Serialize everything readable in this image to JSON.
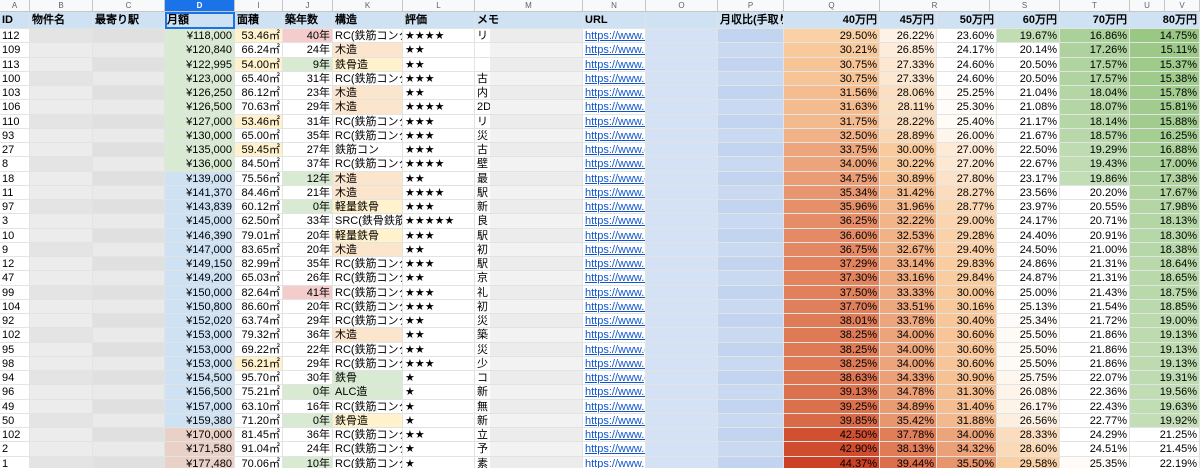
{
  "column_letters": [
    "A",
    "B",
    "C",
    "D",
    "I",
    "J",
    "K",
    "L",
    "M",
    "N",
    "O",
    "P",
    "Q",
    "R",
    "S",
    "T",
    "U",
    "V"
  ],
  "headers": {
    "id": "ID",
    "name": "物件名",
    "station": "最寄り駅",
    "rent": "月額",
    "area": "面積",
    "age": "築年数",
    "structure": "構造",
    "rating": "評価",
    "memo": "メモ",
    "url": "URL",
    "income_ratio": "月収比(手取り)",
    "p40": "40万円",
    "p45": "45万円",
    "p50": "50万円",
    "p60": "60万円",
    "p70": "70万円",
    "p80": "80万円"
  },
  "colors": {
    "header_bg": "#cfe2f3",
    "selected_col": "#1a73e8",
    "link": "#1155cc"
  },
  "rows": [
    {
      "id": "112",
      "rent": "¥118,000",
      "area": "53.46㎡",
      "age": "40年",
      "structure": "RC(鉄筋コンクリ",
      "rating": "★★★★",
      "memo": "リ",
      "url": "https://www.ho",
      "p40": "29.50%",
      "p45": "26.22%",
      "p50": "23.60%",
      "p60": "19.67%",
      "p70": "16.86%",
      "p80": "14.75%"
    },
    {
      "id": "109",
      "rent": "¥120,840",
      "area": "66.24㎡",
      "age": "24年",
      "structure": "木造",
      "rating": "★★",
      "memo": "",
      "url": "https://www.ho",
      "p40": "30.21%",
      "p45": "26.85%",
      "p50": "24.17%",
      "p60": "20.14%",
      "p70": "17.26%",
      "p80": "15.11%"
    },
    {
      "id": "113",
      "rent": "¥122,995",
      "area": "54.00㎡",
      "age": "9年",
      "structure": "鉄骨造",
      "rating": "★★",
      "memo": "",
      "url": "https://www.ho",
      "p40": "30.75%",
      "p45": "27.33%",
      "p50": "24.60%",
      "p60": "20.50%",
      "p70": "17.57%",
      "p80": "15.37%"
    },
    {
      "id": "100",
      "rent": "¥123,000",
      "area": "65.40㎡",
      "age": "31年",
      "structure": "RC(鉄筋コンクリ",
      "rating": "★★★",
      "memo": "古",
      "url": "https://www.ho",
      "p40": "30.75%",
      "p45": "27.33%",
      "p50": "24.60%",
      "p60": "20.50%",
      "p70": "17.57%",
      "p80": "15.38%"
    },
    {
      "id": "103",
      "rent": "¥126,250",
      "area": "86.12㎡",
      "age": "23年",
      "structure": "木造",
      "rating": "★★",
      "memo": "内",
      "url": "https://www.ho",
      "p40": "31.56%",
      "p45": "28.06%",
      "p50": "25.25%",
      "p60": "21.04%",
      "p70": "18.04%",
      "p80": "15.78%"
    },
    {
      "id": "106",
      "rent": "¥126,500",
      "area": "70.63㎡",
      "age": "29年",
      "structure": "木造",
      "rating": "★★★★",
      "memo": "2D",
      "url": "https://www.ho",
      "p40": "31.63%",
      "p45": "28.11%",
      "p50": "25.30%",
      "p60": "21.08%",
      "p70": "18.07%",
      "p80": "15.81%"
    },
    {
      "id": "110",
      "rent": "¥127,000",
      "area": "53.46㎡",
      "age": "31年",
      "structure": "RC(鉄筋コンクリ",
      "rating": "★★★",
      "memo": "リ",
      "url": "https://www.ho",
      "p40": "31.75%",
      "p45": "28.22%",
      "p50": "25.40%",
      "p60": "21.17%",
      "p70": "18.14%",
      "p80": "15.88%"
    },
    {
      "id": "93",
      "rent": "¥130,000",
      "area": "65.00㎡",
      "age": "35年",
      "structure": "RC(鉄筋コンクリ",
      "rating": "★★★",
      "memo": "災",
      "url": "https://www.ho",
      "p40": "32.50%",
      "p45": "28.89%",
      "p50": "26.00%",
      "p60": "21.67%",
      "p70": "18.57%",
      "p80": "16.25%"
    },
    {
      "id": "27",
      "rent": "¥135,000",
      "area": "59.45㎡",
      "age": "27年",
      "structure": "鉄筋コン",
      "rating": "★★★",
      "memo": "古",
      "url": "https://www.go",
      "p40": "33.75%",
      "p45": "30.00%",
      "p50": "27.00%",
      "p60": "22.50%",
      "p70": "19.29%",
      "p80": "16.88%"
    },
    {
      "id": "8",
      "rent": "¥136,000",
      "area": "84.50㎡",
      "age": "37年",
      "structure": "RC(鉄筋コンクリ",
      "rating": "★★★★",
      "memo": "壁",
      "url": "https://www.ho",
      "p40": "34.00%",
      "p45": "30.22%",
      "p50": "27.20%",
      "p60": "22.67%",
      "p70": "19.43%",
      "p80": "17.00%"
    },
    {
      "id": "18",
      "rent": "¥139,000",
      "area": "75.56㎡",
      "age": "12年",
      "structure": "木造",
      "rating": "★★",
      "memo": "最",
      "url": "https://www.go",
      "p40": "34.75%",
      "p45": "30.89%",
      "p50": "27.80%",
      "p60": "23.17%",
      "p70": "19.86%",
      "p80": "17.38%"
    },
    {
      "id": "11",
      "rent": "¥141,370",
      "area": "84.46㎡",
      "age": "21年",
      "structure": "木造",
      "rating": "★★★★",
      "memo": "駅",
      "url": "https://www.ho",
      "p40": "35.34%",
      "p45": "31.42%",
      "p50": "28.27%",
      "p60": "23.56%",
      "p70": "20.20%",
      "p80": "17.67%"
    },
    {
      "id": "97",
      "rent": "¥143,839",
      "area": "60.12㎡",
      "age": "0年",
      "structure": "軽量鉄骨",
      "rating": "★★★",
      "memo": "新",
      "url": "https://www.ho",
      "p40": "35.96%",
      "p45": "31.96%",
      "p50": "28.77%",
      "p60": "23.97%",
      "p70": "20.55%",
      "p80": "17.98%"
    },
    {
      "id": "3",
      "rent": "¥145,000",
      "area": "62.50㎡",
      "age": "33年",
      "structure": "SRC(鉄骨鉄筋コ",
      "rating": "★★★★★",
      "memo": "良",
      "url": "https://www.ho",
      "p40": "36.25%",
      "p45": "32.22%",
      "p50": "29.00%",
      "p60": "24.17%",
      "p70": "20.71%",
      "p80": "18.13%"
    },
    {
      "id": "10",
      "rent": "¥146,390",
      "area": "79.01㎡",
      "age": "20年",
      "structure": "軽量鉄骨",
      "rating": "★★★",
      "memo": "駅",
      "url": "https://www.ho",
      "p40": "36.60%",
      "p45": "32.53%",
      "p50": "29.28%",
      "p60": "24.40%",
      "p70": "20.91%",
      "p80": "18.30%"
    },
    {
      "id": "9",
      "rent": "¥147,000",
      "area": "83.65㎡",
      "age": "20年",
      "structure": "木造",
      "rating": "★★",
      "memo": "初",
      "url": "https://www.ho",
      "p40": "36.75%",
      "p45": "32.67%",
      "p50": "29.40%",
      "p60": "24.50%",
      "p70": "21.00%",
      "p80": "18.38%"
    },
    {
      "id": "12",
      "rent": "¥149,150",
      "area": "82.99㎡",
      "age": "35年",
      "structure": "RC(鉄筋コンクリ",
      "rating": "★★★",
      "memo": "駅",
      "url": "https://www.ho",
      "p40": "37.29%",
      "p45": "33.14%",
      "p50": "29.83%",
      "p60": "24.86%",
      "p70": "21.31%",
      "p80": "18.64%"
    },
    {
      "id": "47",
      "rent": "¥149,200",
      "area": "65.03㎡",
      "age": "26年",
      "structure": "RC(鉄筋コンクリ",
      "rating": "★★",
      "memo": "京",
      "url": "https://www.ho",
      "p40": "37.30%",
      "p45": "33.16%",
      "p50": "29.84%",
      "p60": "24.87%",
      "p70": "21.31%",
      "p80": "18.65%"
    },
    {
      "id": "99",
      "rent": "¥150,000",
      "area": "82.64㎡",
      "age": "41年",
      "structure": "RC(鉄筋コンクリ",
      "rating": "★★★",
      "memo": "礼",
      "url": "https://www.ho",
      "p40": "37.50%",
      "p45": "33.33%",
      "p50": "30.00%",
      "p60": "25.00%",
      "p70": "21.43%",
      "p80": "18.75%"
    },
    {
      "id": "104",
      "rent": "¥150,800",
      "area": "86.60㎡",
      "age": "20年",
      "structure": "RC(鉄筋コンクリ",
      "rating": "★★★",
      "memo": "初",
      "url": "https://www.ho",
      "p40": "37.70%",
      "p45": "33.51%",
      "p50": "30.16%",
      "p60": "25.13%",
      "p70": "21.54%",
      "p80": "18.85%"
    },
    {
      "id": "92",
      "rent": "¥152,020",
      "area": "63.74㎡",
      "age": "29年",
      "structure": "RC(鉄筋コンクリ",
      "rating": "★★",
      "memo": "災",
      "url": "https://www.ho",
      "p40": "38.01%",
      "p45": "33.78%",
      "p50": "30.40%",
      "p60": "25.34%",
      "p70": "21.72%",
      "p80": "19.00%"
    },
    {
      "id": "102",
      "rent": "¥153,000",
      "area": "79.32㎡",
      "age": "36年",
      "structure": "木造",
      "rating": "★★",
      "memo": "築",
      "url": "https://www.ho",
      "p40": "38.25%",
      "p45": "34.00%",
      "p50": "30.60%",
      "p60": "25.50%",
      "p70": "21.86%",
      "p80": "19.13%"
    },
    {
      "id": "95",
      "rent": "¥153,000",
      "area": "69.22㎡",
      "age": "22年",
      "structure": "RC(鉄筋コンクリ",
      "rating": "★★",
      "memo": "災",
      "url": "https://www.go",
      "p40": "38.25%",
      "p45": "34.00%",
      "p50": "30.60%",
      "p60": "25.50%",
      "p70": "21.86%",
      "p80": "19.13%"
    },
    {
      "id": "98",
      "rent": "¥153,000",
      "area": "56.21㎡",
      "age": "29年",
      "structure": "RC(鉄筋コンクリ",
      "rating": "★★★",
      "memo": "少",
      "url": "https://www.ho",
      "p40": "38.25%",
      "p45": "34.00%",
      "p50": "30.60%",
      "p60": "25.50%",
      "p70": "21.86%",
      "p80": "19.13%"
    },
    {
      "id": "94",
      "rent": "¥154,500",
      "area": "95.70㎡",
      "age": "30年",
      "structure": "鉄骨",
      "rating": "★",
      "memo": "コ",
      "url": "https://www.go",
      "p40": "38.63%",
      "p45": "34.33%",
      "p50": "30.90%",
      "p60": "25.75%",
      "p70": "22.07%",
      "p80": "19.31%"
    },
    {
      "id": "96",
      "rent": "¥156,500",
      "area": "75.21㎡",
      "age": "0年",
      "structure": "ALC造",
      "rating": "★",
      "memo": "新",
      "url": "https://www.ho",
      "p40": "39.13%",
      "p45": "34.78%",
      "p50": "31.30%",
      "p60": "26.08%",
      "p70": "22.36%",
      "p80": "19.56%"
    },
    {
      "id": "49",
      "rent": "¥157,000",
      "area": "63.10㎡",
      "age": "16年",
      "structure": "RC(鉄筋コンクリ",
      "rating": "★",
      "memo": "無",
      "url": "https://www.ho",
      "p40": "39.25%",
      "p45": "34.89%",
      "p50": "31.40%",
      "p60": "26.17%",
      "p70": "22.43%",
      "p80": "19.63%"
    },
    {
      "id": "50",
      "rent": "¥159,380",
      "area": "71.20㎡",
      "age": "0年",
      "structure": "鉄骨造",
      "rating": "★",
      "memo": "新",
      "url": "https://www.ho",
      "p40": "39.85%",
      "p45": "35.42%",
      "p50": "31.88%",
      "p60": "26.56%",
      "p70": "22.77%",
      "p80": "19.92%"
    },
    {
      "id": "102",
      "rent": "¥170,000",
      "area": "81.45㎡",
      "age": "36年",
      "structure": "RC(鉄筋コンクリ",
      "rating": "★★",
      "memo": "立",
      "url": "https://www.ho",
      "p40": "42.50%",
      "p45": "37.78%",
      "p50": "34.00%",
      "p60": "28.33%",
      "p70": "24.29%",
      "p80": "21.25%"
    },
    {
      "id": "2",
      "rent": "¥171,580",
      "area": "91.04㎡",
      "age": "24年",
      "structure": "RC(鉄筋コンクリ",
      "rating": "★",
      "memo": "予",
      "url": "https://www.ho",
      "p40": "42.90%",
      "p45": "38.13%",
      "p50": "34.32%",
      "p60": "28.60%",
      "p70": "24.51%",
      "p80": "21.45%"
    },
    {
      "id": "1",
      "rent": "¥177,480",
      "area": "70.06㎡",
      "age": "10年",
      "structure": "RC(鉄筋コンクリ",
      "rating": "★",
      "memo": "素",
      "url": "https://www.ho",
      "p40": "44.37%",
      "p45": "39.44%",
      "p50": "35.50%",
      "p60": "29.58%",
      "p70": "25.35%",
      "p80": "22.19%"
    }
  ]
}
